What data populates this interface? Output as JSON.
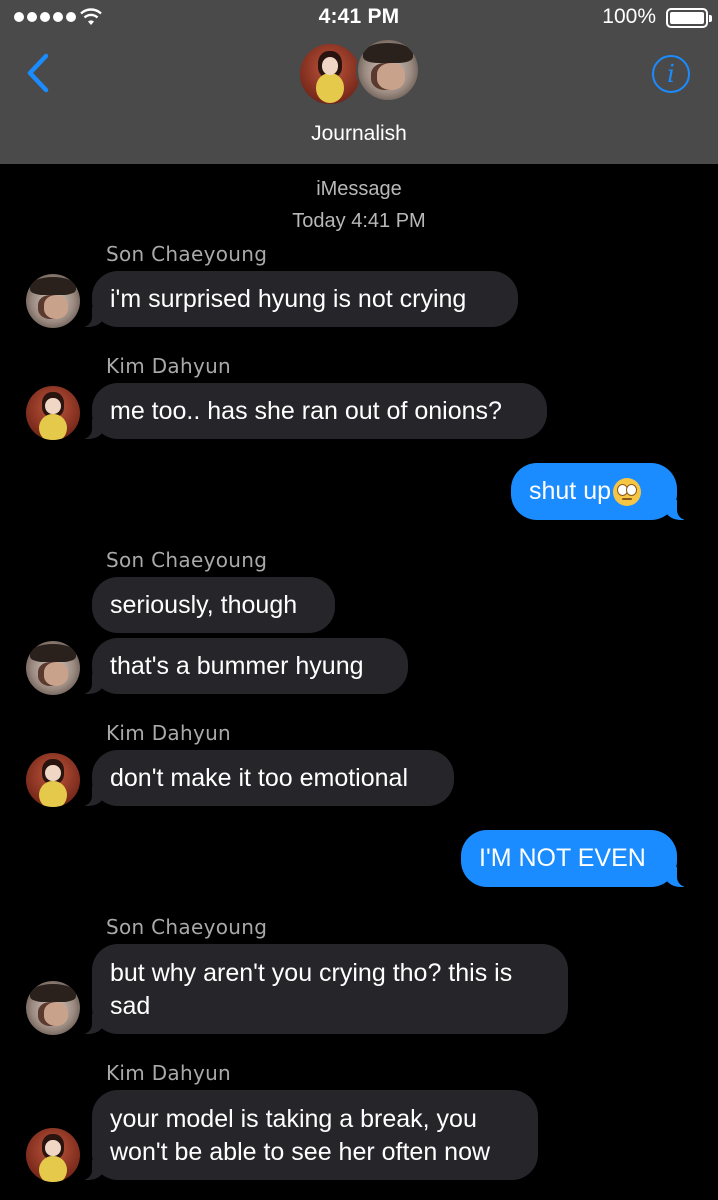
{
  "status_bar": {
    "time": "4:41 PM",
    "battery": "100%",
    "signal_bars": 5
  },
  "header": {
    "title": "Journalish",
    "back_icon": "chevron-left-icon",
    "info_icon": "info-icon",
    "info_glyph": "i",
    "accent_color": "#1a8cff",
    "background_color": "#4a4a4a"
  },
  "thread": {
    "service": "iMessage",
    "timestamp": "Today 4:41 PM"
  },
  "messages": [
    {
      "sender": "Son Chaeyoung",
      "direction": "incoming",
      "text": "i'm surprised hyung is not crying"
    },
    {
      "sender": "Kim Dahyun",
      "direction": "incoming",
      "text": "me too.. has she ran out of onions?"
    },
    {
      "sender": "",
      "direction": "outgoing",
      "text": "shut up",
      "emoji": "face-with-rolling-eyes"
    },
    {
      "sender": "Son Chaeyoung",
      "direction": "incoming",
      "text": "seriously, though"
    },
    {
      "sender": "Son Chaeyoung",
      "direction": "incoming",
      "text": "that's a bummer hyung"
    },
    {
      "sender": "Kim Dahyun",
      "direction": "incoming",
      "text": "don't make it too emotional"
    },
    {
      "sender": "",
      "direction": "outgoing",
      "text": "I'M NOT EVEN"
    },
    {
      "sender": "Son Chaeyoung",
      "direction": "incoming",
      "text": "but why aren't you crying tho? this is sad"
    },
    {
      "sender": "Kim Dahyun",
      "direction": "incoming",
      "text": "your model is taking a break, you won't be able to see her often now"
    }
  ],
  "colors": {
    "incoming_bubble": "#26252a",
    "outgoing_bubble": "#1a8cff",
    "background": "#000000"
  }
}
